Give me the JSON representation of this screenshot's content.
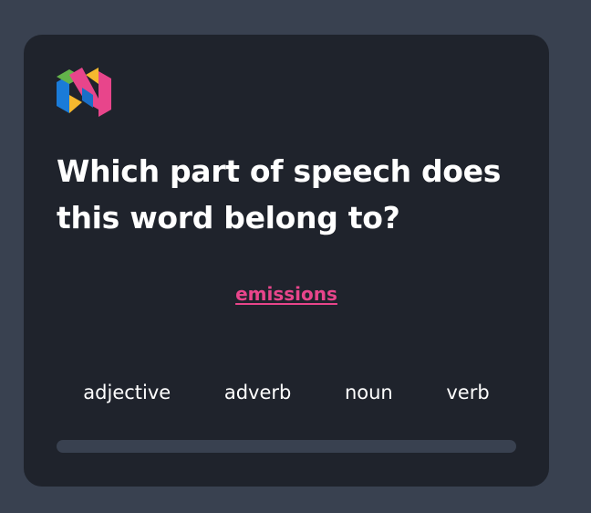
{
  "question": {
    "text": "Which part of speech does this word belong to?"
  },
  "word": {
    "text": "emissions"
  },
  "options": [
    {
      "label": "adjective"
    },
    {
      "label": "adverb"
    },
    {
      "label": "noun"
    },
    {
      "label": "verb"
    }
  ],
  "progress": {
    "fraction": 0
  },
  "colors": {
    "page_background": "#394150",
    "card_background": "#1f232c",
    "accent_pink": "#e8458b",
    "text": "#ffffff",
    "progress_track": "#394150"
  },
  "icons": {
    "logo": "brand-logo-icon"
  }
}
